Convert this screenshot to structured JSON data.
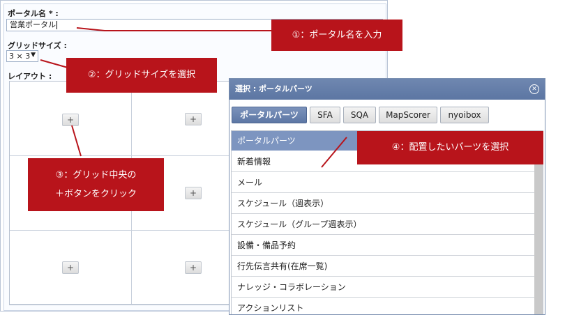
{
  "form": {
    "portal_name_label": "ポータル名 * :",
    "portal_name_value": "営業ポータル",
    "grid_size_label": "グリッドサイズ :",
    "grid_size_value": "3 × 3",
    "layout_label": "レイアウト :",
    "plus_label": "+"
  },
  "dialog": {
    "title": "選択 : ポータルパーツ",
    "tabs": [
      {
        "label": "ポータルパーツ"
      },
      {
        "label": "SFA"
      },
      {
        "label": "SQA"
      },
      {
        "label": "MapScorer"
      },
      {
        "label": "nyoibox"
      }
    ],
    "list_header": "ポータルパーツ",
    "items": [
      "新着情報",
      "メール",
      "スケジュール（週表示）",
      "スケジュール（グループ週表示）",
      "設備・備品予約",
      "行先伝言共有(在席一覧)",
      "ナレッジ・コラボレーション",
      "アクションリスト"
    ]
  },
  "callouts": {
    "c1": "①：ポータル名を入力",
    "c2": "②：グリッドサイズを選択",
    "c3_line1": "③：グリッド中央の",
    "c3_line2": "＋ボタンをクリック",
    "c4": "④：配置したいパーツを選択"
  },
  "colors": {
    "callout": "#b8141b",
    "dialog_title": "#5c76a3",
    "list_header": "#7d95c0"
  }
}
